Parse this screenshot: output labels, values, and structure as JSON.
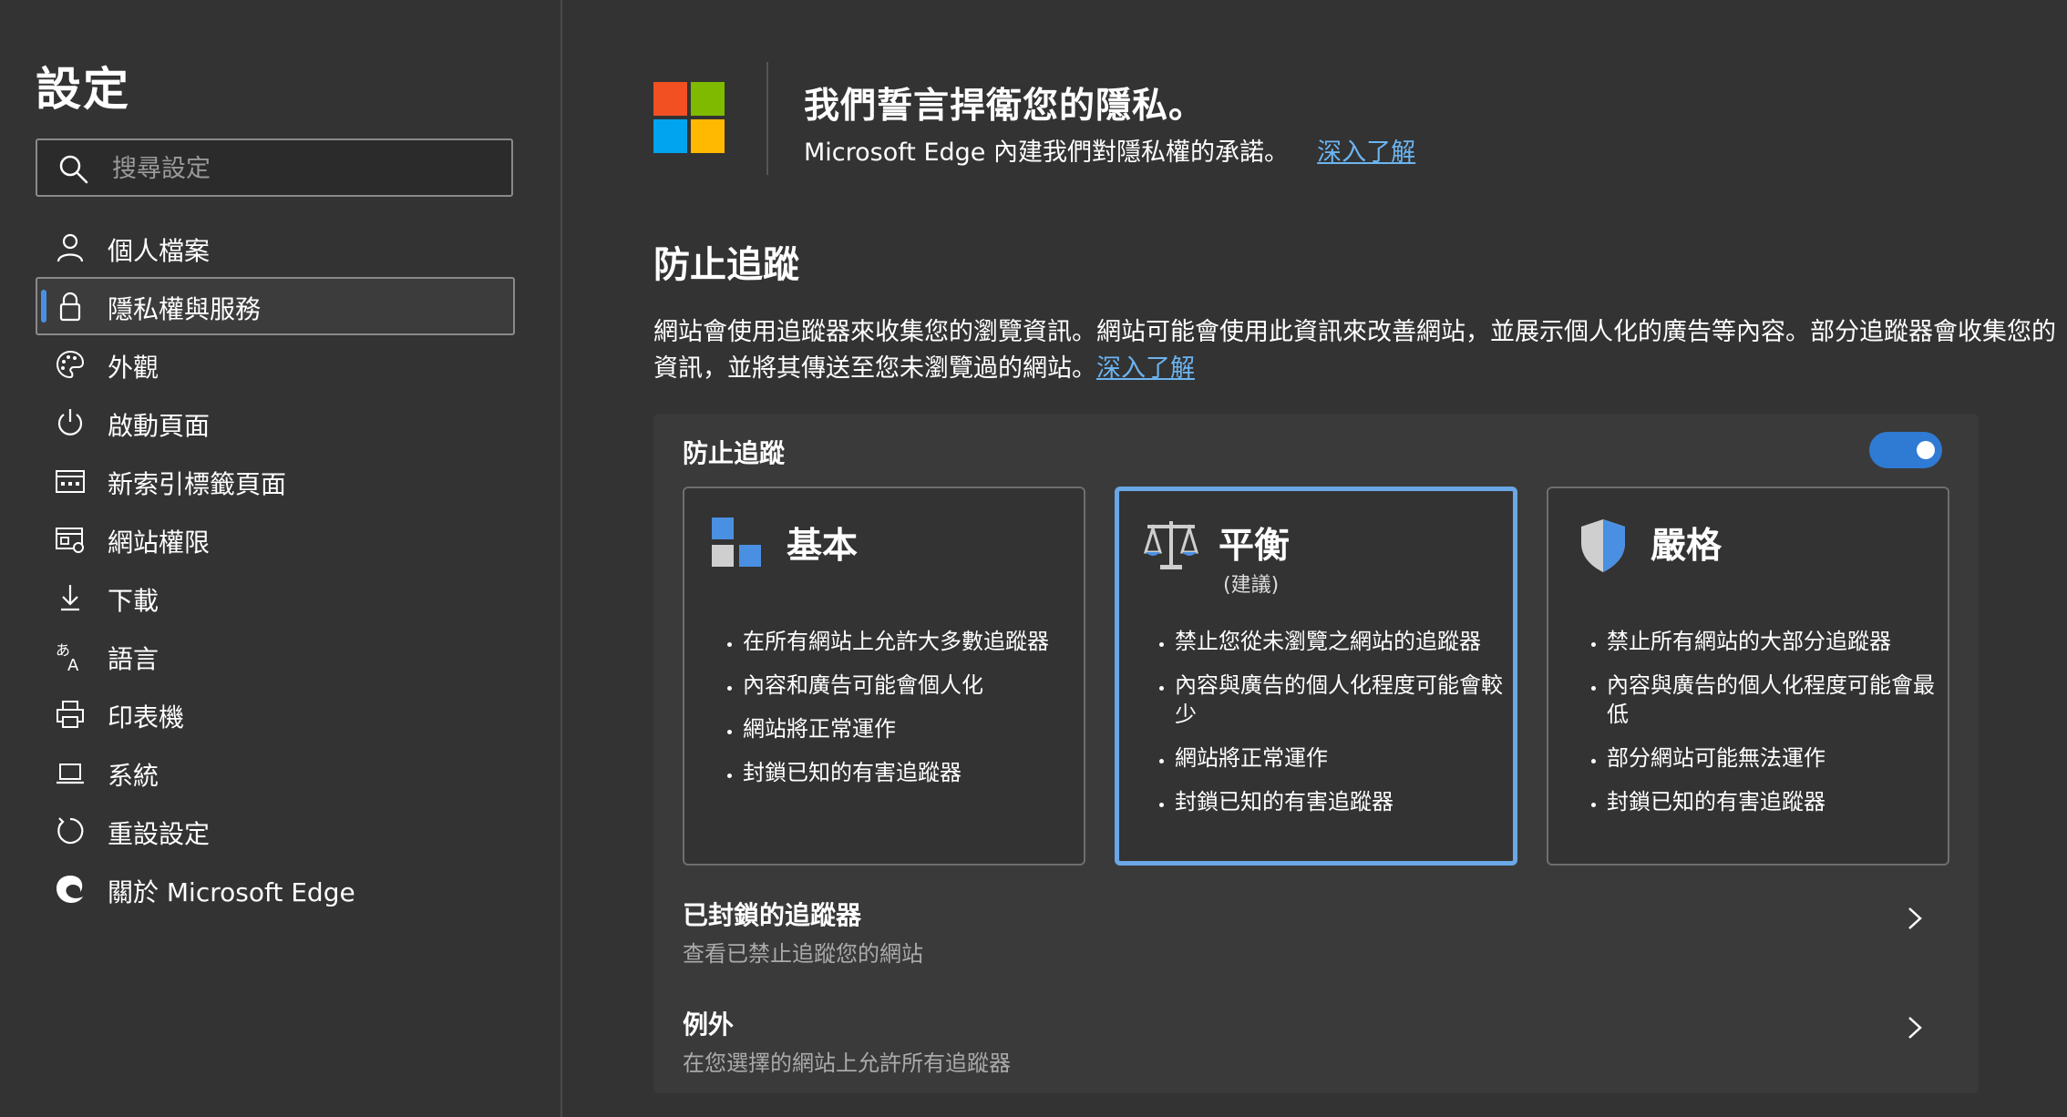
{
  "sidebar": {
    "title": "設定",
    "search_placeholder": "搜尋設定",
    "items": [
      {
        "label": "個人檔案",
        "icon": "person-icon"
      },
      {
        "label": "隱私權與服務",
        "icon": "lock-icon",
        "active": true
      },
      {
        "label": "外觀",
        "icon": "palette-icon"
      },
      {
        "label": "啟動頁面",
        "icon": "power-icon"
      },
      {
        "label": "新索引標籤頁面",
        "icon": "newtab-icon"
      },
      {
        "label": "網站權限",
        "icon": "site-permissions-icon"
      },
      {
        "label": "下載",
        "icon": "download-icon"
      },
      {
        "label": "語言",
        "icon": "language-icon"
      },
      {
        "label": "印表機",
        "icon": "printer-icon"
      },
      {
        "label": "系統",
        "icon": "laptop-icon"
      },
      {
        "label": "重設設定",
        "icon": "reset-icon"
      },
      {
        "label": "關於 Microsoft Edge",
        "icon": "edge-logo-icon"
      }
    ]
  },
  "header": {
    "title": "我們誓言捍衛您的隱私。",
    "subtitle": "Microsoft Edge 內建我們對隱私權的承諾。",
    "link": "深入了解",
    "logo_colors": [
      "#f25022",
      "#7fba00",
      "#00a4ef",
      "#ffb900"
    ]
  },
  "tracking": {
    "section_title": "防止追蹤",
    "description": "網站會使用追蹤器來收集您的瀏覽資訊。網站可能會使用此資訊來改善網站，並展示個人化的廣告等內容。部分追蹤器會收集您的資訊，並將其傳送至您未瀏覽過的網站。",
    "link": "深入了解",
    "panel_label": "防止追蹤",
    "toggle_on": true,
    "accent_color": "#2f7ad3",
    "cards": [
      {
        "title": "基本",
        "subtitle": "",
        "icon": "basic-blocks-icon",
        "bullets": [
          "在所有網站上允許大多數追蹤器",
          "內容和廣告可能會個人化",
          "網站將正常運作",
          "封鎖已知的有害追蹤器"
        ]
      },
      {
        "title": "平衡",
        "subtitle": "(建議)",
        "icon": "balance-scale-icon",
        "selected": true,
        "bullets": [
          "禁止您從未瀏覽之網站的追蹤器",
          "內容與廣告的個人化程度可能會較少",
          "網站將正常運作",
          "封鎖已知的有害追蹤器"
        ]
      },
      {
        "title": "嚴格",
        "subtitle": "",
        "icon": "shield-icon",
        "bullets": [
          "禁止所有網站的大部分追蹤器",
          "內容與廣告的個人化程度可能會最低",
          "部分網站可能無法運作",
          "封鎖已知的有害追蹤器"
        ]
      }
    ],
    "blocked": {
      "title": "已封鎖的追蹤器",
      "desc": "查看已禁止追蹤您的網站"
    },
    "exceptions": {
      "title": "例外",
      "desc": "在您選擇的網站上允許所有追蹤器"
    }
  }
}
